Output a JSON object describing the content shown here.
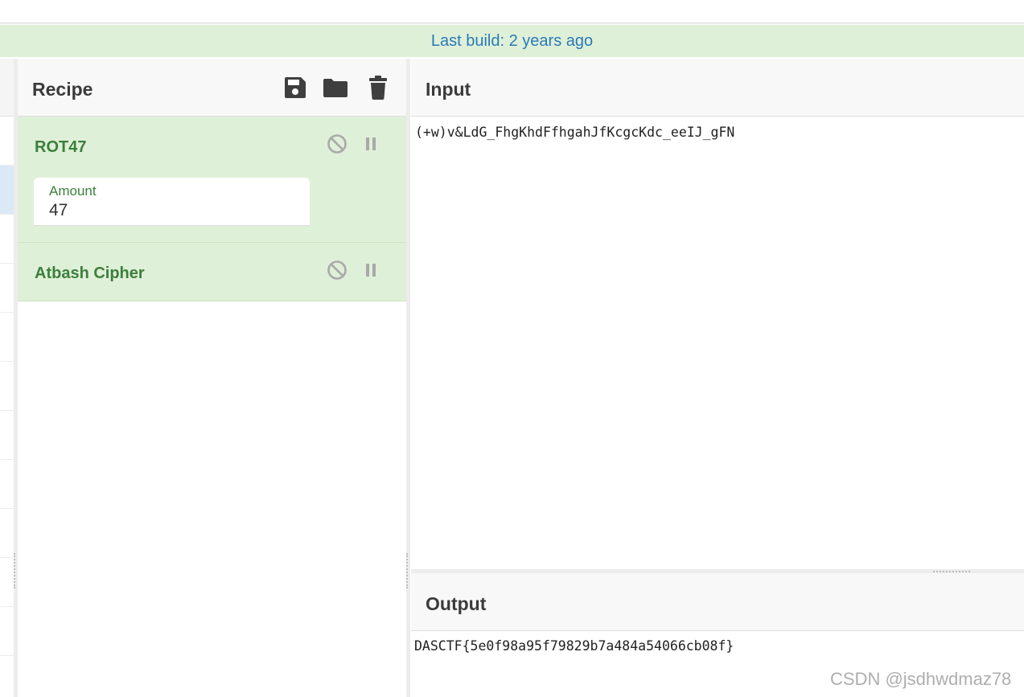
{
  "banner": {
    "text": "Last build: 2 years ago"
  },
  "recipe": {
    "title": "Recipe",
    "icons": [
      "save-icon",
      "folder-icon",
      "trash-icon"
    ],
    "operations": [
      {
        "name": "ROT47",
        "args": [
          {
            "label": "Amount",
            "value": "47"
          }
        ]
      },
      {
        "name": "Atbash Cipher",
        "args": []
      }
    ]
  },
  "input": {
    "title": "Input",
    "value": "(+w)v&LdG_FhgKhdFfhgahJfKcgcKdc_eeIJ_gFN"
  },
  "output": {
    "title": "Output",
    "value": "DASCTF{5e0f98a95f79829b7a484a54066cb08f}"
  },
  "watermark": "CSDN @jsdhwdmaz78",
  "colors": {
    "banner_bg": "#dff0d8",
    "banner_text": "#2a7ab8",
    "op_bg": "#dff0d8",
    "op_title": "#3c7f3c",
    "icon": "#3f3f3f",
    "op_icon": "#a9a9a9"
  }
}
